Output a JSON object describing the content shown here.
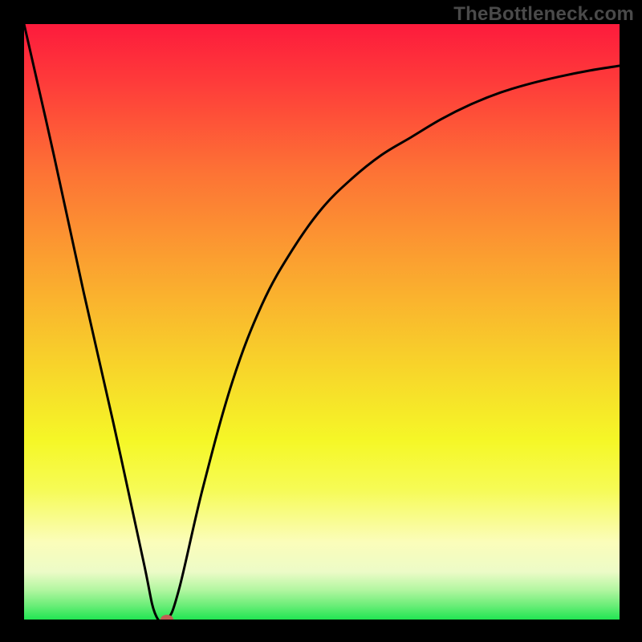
{
  "watermark": "TheBottleneck.com",
  "chart_data": {
    "type": "line",
    "title": "",
    "xlabel": "",
    "ylabel": "",
    "xlim": [
      0,
      100
    ],
    "ylim": [
      0,
      100
    ],
    "grid": false,
    "legend": false,
    "series": [
      {
        "name": "bottleneck-curve",
        "x": [
          0,
          5,
          10,
          15,
          20,
          22,
          24,
          26,
          30,
          35,
          40,
          45,
          50,
          55,
          60,
          65,
          70,
          75,
          80,
          85,
          90,
          95,
          100
        ],
        "y": [
          100,
          78,
          55,
          33,
          10,
          1,
          0,
          5,
          22,
          40,
          53,
          62,
          69,
          74,
          78,
          81,
          84,
          86.5,
          88.5,
          90,
          91.2,
          92.2,
          93
        ]
      }
    ],
    "marker": {
      "x": 24,
      "y": 0,
      "color": "#c15e54"
    },
    "gradient_stops": [
      {
        "offset": 0,
        "color": "#fd1b3c"
      },
      {
        "offset": 0.1,
        "color": "#fe3c3a"
      },
      {
        "offset": 0.25,
        "color": "#fd7335"
      },
      {
        "offset": 0.4,
        "color": "#fba130"
      },
      {
        "offset": 0.55,
        "color": "#f8cd2b"
      },
      {
        "offset": 0.7,
        "color": "#f5f727"
      },
      {
        "offset": 0.78,
        "color": "#f6fb54"
      },
      {
        "offset": 0.87,
        "color": "#fbfdba"
      },
      {
        "offset": 0.92,
        "color": "#ecfbc7"
      },
      {
        "offset": 0.95,
        "color": "#b3f6a1"
      },
      {
        "offset": 0.975,
        "color": "#6eee7a"
      },
      {
        "offset": 1.0,
        "color": "#22e552"
      }
    ],
    "curve_stroke": "#000000",
    "curve_width": 3
  }
}
